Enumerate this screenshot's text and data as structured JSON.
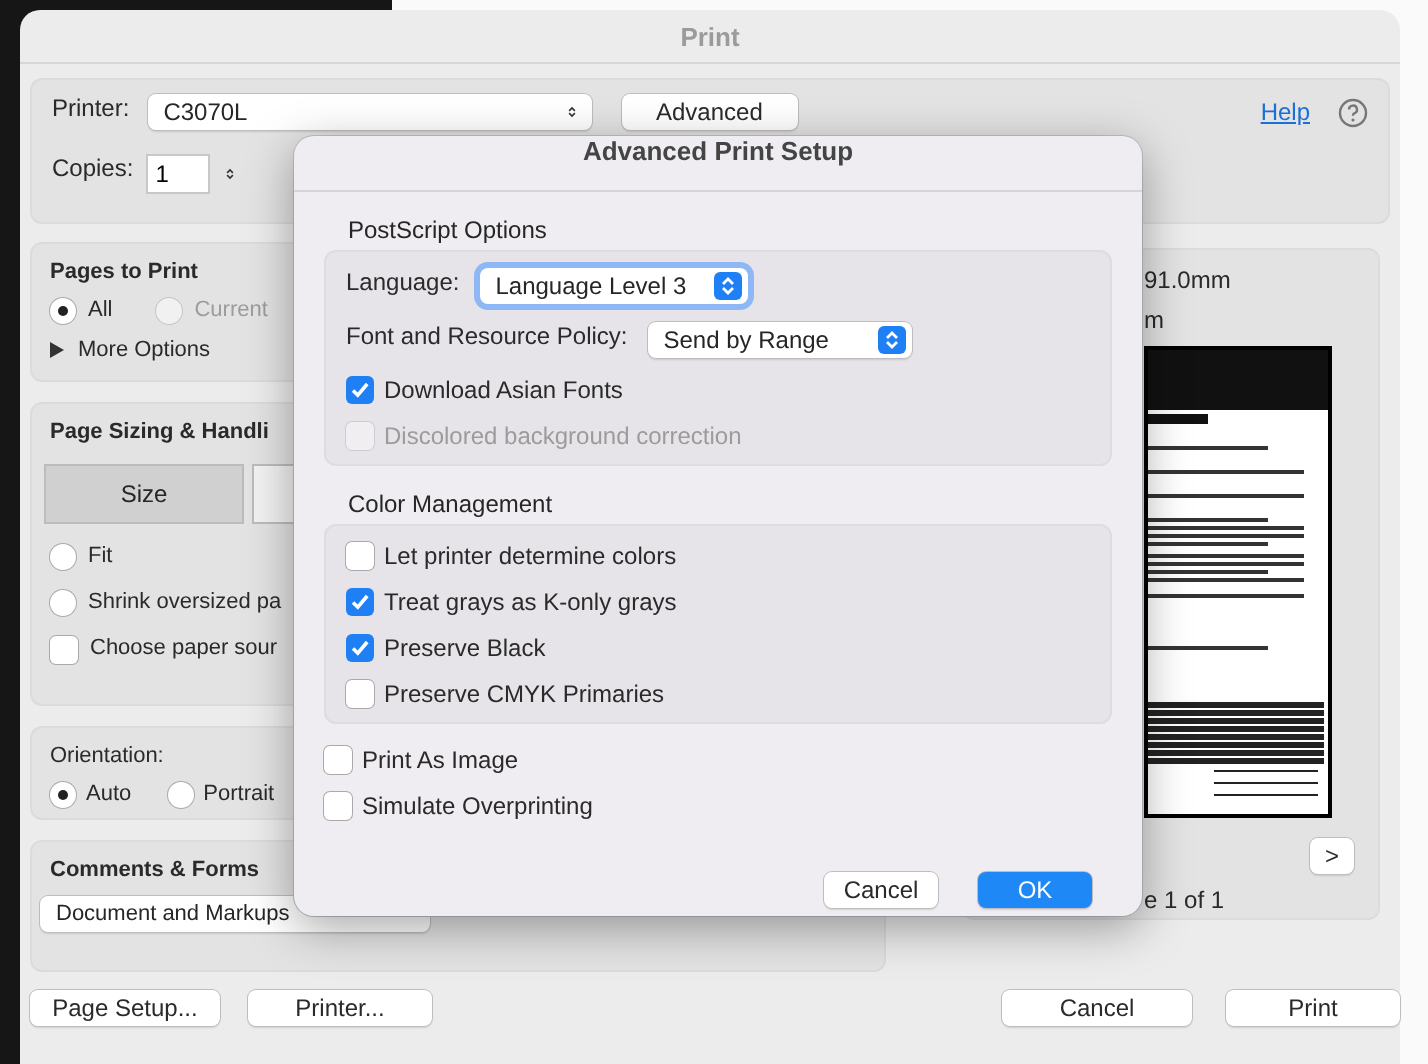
{
  "window": {
    "title": "Print"
  },
  "printer": {
    "label": "Printer:",
    "value": "C3070L",
    "advanced_button": "Advanced",
    "help_link": "Help"
  },
  "copies": {
    "label": "Copies:",
    "value": "1"
  },
  "pages_to_print": {
    "title": "Pages to Print",
    "options": [
      {
        "label": "All",
        "selected": true,
        "disabled": false
      },
      {
        "label": "Current",
        "selected": false,
        "disabled": true
      }
    ],
    "more_options": "More Options"
  },
  "page_sizing": {
    "title": "Page Sizing & Handli",
    "tabs": [
      {
        "label": "Size",
        "selected": true
      }
    ],
    "options": [
      {
        "kind": "radio",
        "label": "Fit",
        "checked": false
      },
      {
        "kind": "radio",
        "label": "Shrink oversized pa",
        "checked": false
      },
      {
        "kind": "checkbox",
        "label": "Choose paper sour",
        "checked": false
      }
    ]
  },
  "orientation": {
    "label": "Orientation:",
    "options": [
      {
        "label": "Auto",
        "selected": true
      },
      {
        "label": "Portrait",
        "selected": false
      }
    ]
  },
  "comments_forms": {
    "title": "Comments & Forms",
    "dropdown": "Document and Markups"
  },
  "preview": {
    "size_line_1": "91.0mm",
    "size_line_2": "m",
    "next_button": ">",
    "page_indicator": "e 1 of 1"
  },
  "footer": {
    "left_buttons": [
      "Page Setup...",
      "Printer..."
    ],
    "right_buttons": [
      "Cancel",
      "Print"
    ]
  },
  "dialog": {
    "title": "Advanced Print Setup",
    "sections": [
      {
        "title": "PostScript Options",
        "rows": [
          {
            "kind": "select",
            "label": "Language:",
            "value": "Language Level 3",
            "focused": true
          },
          {
            "kind": "select",
            "label": "Font and Resource Policy:",
            "value": "Send by Range",
            "focused": false
          },
          {
            "kind": "checkbox",
            "label": "Download Asian Fonts",
            "checked": true,
            "disabled": false
          },
          {
            "kind": "checkbox",
            "label": "Discolored background correction",
            "checked": false,
            "disabled": true
          }
        ]
      },
      {
        "title": "Color Management",
        "rows": [
          {
            "kind": "checkbox",
            "label": "Let printer determine colors",
            "checked": false,
            "disabled": false
          },
          {
            "kind": "checkbox",
            "label": "Treat grays as K-only grays",
            "checked": true,
            "disabled": false
          },
          {
            "kind": "checkbox",
            "label": "Preserve Black",
            "checked": true,
            "disabled": false
          },
          {
            "kind": "checkbox",
            "label": "Preserve CMYK Primaries",
            "checked": false,
            "disabled": false
          }
        ]
      }
    ],
    "extra_options": [
      {
        "label": "Print As Image",
        "checked": false
      },
      {
        "label": "Simulate Overprinting",
        "checked": false
      }
    ],
    "buttons": [
      {
        "label": "Cancel",
        "primary": false
      },
      {
        "label": "OK",
        "primary": true
      }
    ]
  }
}
